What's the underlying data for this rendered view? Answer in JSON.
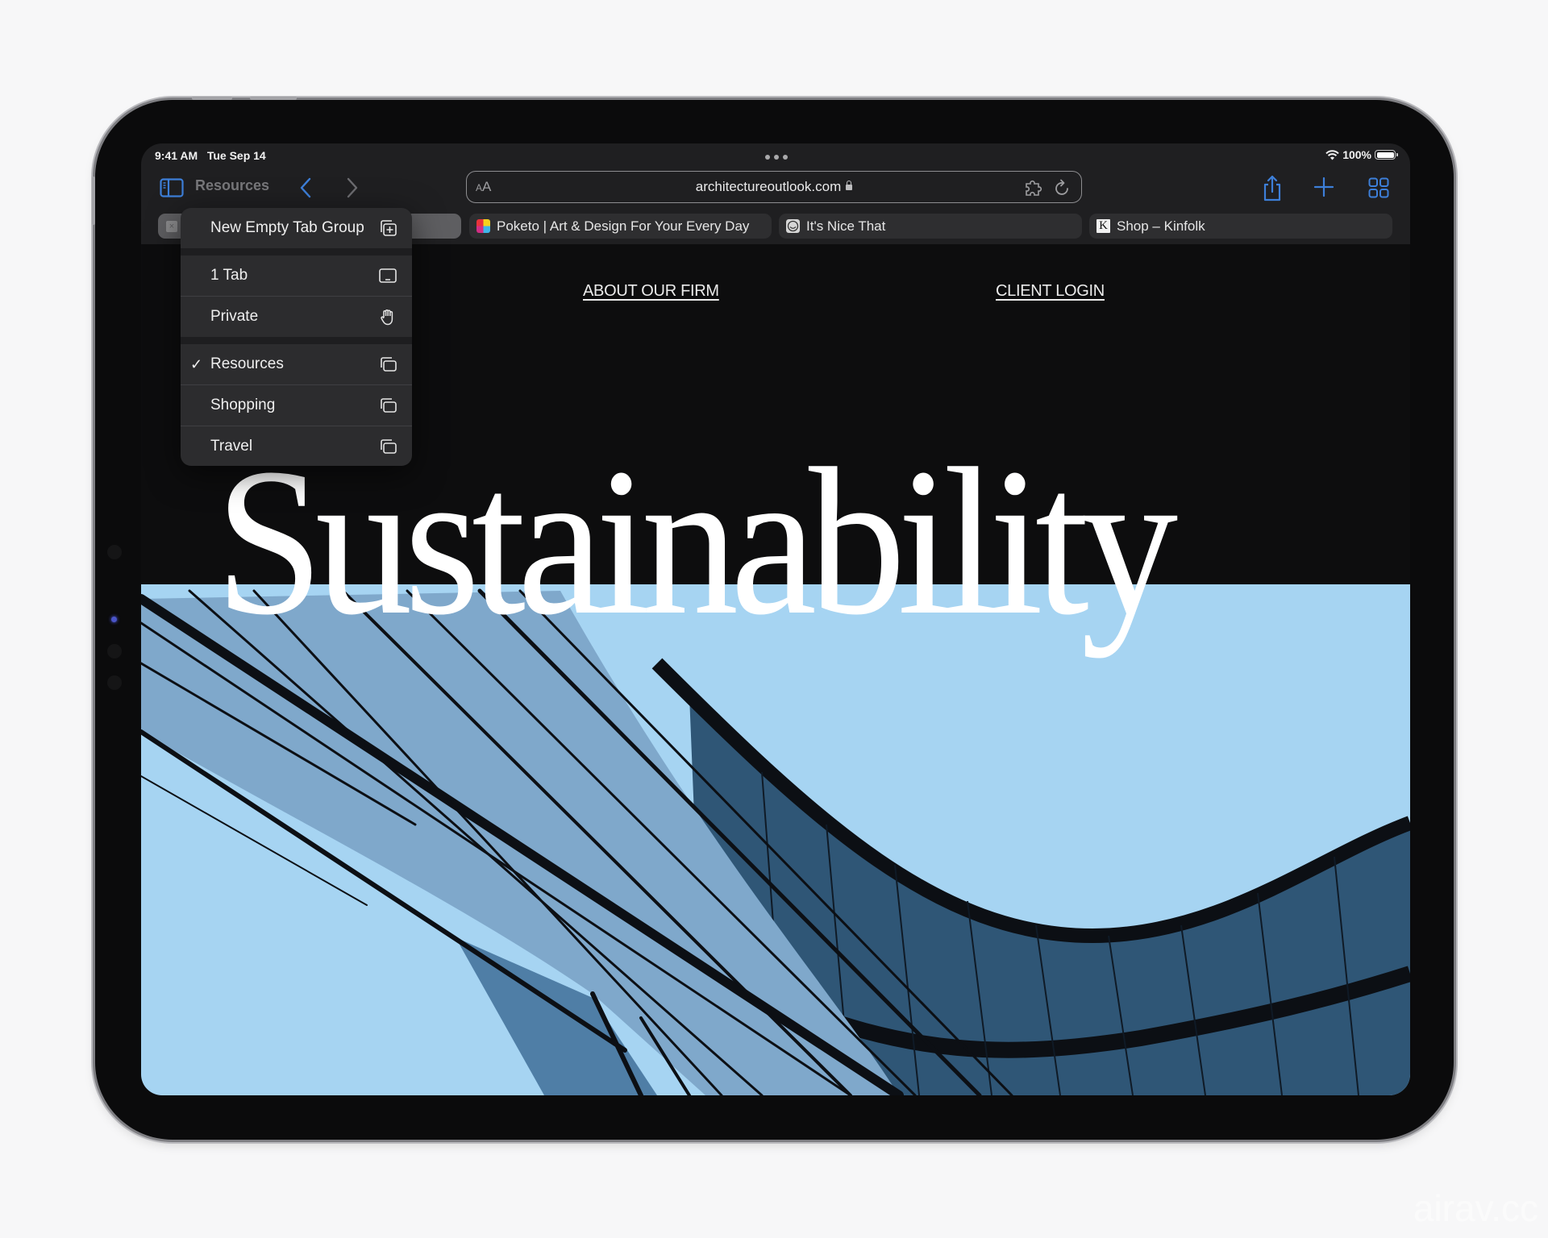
{
  "status_bar": {
    "time": "9:41 AM",
    "date": "Tue Sep 14",
    "battery_label": "100%",
    "battery_level": 1.0,
    "icons": [
      "wifi-icon",
      "battery-icon"
    ]
  },
  "toolbar": {
    "tab_group_title": "Resources",
    "icons": [
      "sidebar-icon",
      "back-chevron-icon",
      "forward-chevron-icon",
      "share-icon",
      "plus-icon",
      "tab-overview-icon"
    ],
    "accent_color": "#3d7fd9"
  },
  "address_bar": {
    "reader_label_small": "A",
    "reader_label_large": "A",
    "url": "architectureoutlook.com",
    "icons": [
      "lock-icon",
      "extension-puzzle-icon",
      "reload-icon"
    ]
  },
  "tabs": [
    {
      "title": "",
      "favicon": "close-icon",
      "active": true
    },
    {
      "title": "Poketo | Art & Design For Your Every Day",
      "favicon": "poketo-favicon",
      "active": false
    },
    {
      "title": "It's Nice That",
      "favicon": "itsnicethat-favicon",
      "active": false
    },
    {
      "title": "Shop – Kinfolk",
      "favicon": "kinfolk-favicon",
      "favicon_letter": "K",
      "active": false
    }
  ],
  "tab_group_menu": {
    "new_group": {
      "label": "New Empty Tab Group",
      "icon": "new-tab-group-icon"
    },
    "sections": [
      [
        {
          "label": "1 Tab",
          "icon": "start-page-icon",
          "checked": false
        },
        {
          "label": "Private",
          "icon": "private-hand-icon",
          "checked": false
        }
      ],
      [
        {
          "label": "Resources",
          "icon": "tab-group-icon",
          "checked": true
        },
        {
          "label": "Shopping",
          "icon": "tab-group-icon",
          "checked": false
        },
        {
          "label": "Travel",
          "icon": "tab-group-icon",
          "checked": false
        }
      ]
    ],
    "check_glyph": "✓"
  },
  "page": {
    "nav_links": [
      "ABOUT OUR FIRM",
      "CLIENT LOGIN"
    ],
    "headline": "Sustainability",
    "colors": {
      "sky": "#a6d4f2",
      "building_dark": "#2f5676",
      "frame": "#0c0f14"
    }
  },
  "watermark": "airav.cc"
}
